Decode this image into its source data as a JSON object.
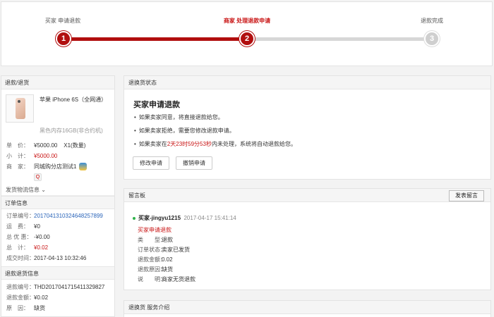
{
  "progress": {
    "steps": [
      {
        "num": "1",
        "label": "买家 申请退款"
      },
      {
        "num": "2",
        "label": "商家 处理退款申请"
      },
      {
        "num": "3",
        "label": "退款完成"
      }
    ]
  },
  "left": {
    "refund_header": "退款/退货",
    "product": {
      "name": "苹果 iPhone 6S（全网通）",
      "spec": "黑色内存16GB(非合约机)"
    },
    "price_label": "单　价：",
    "price_value": "¥5000.00",
    "qty_value": "X1(数量)",
    "subtotal_label": "小　计：",
    "subtotal_value": "¥5000.00",
    "seller_label": "商　家：",
    "seller_value": "同城购分店测试1",
    "logistics_label": "发货物流信息",
    "order_header": "订单信息",
    "order_no_label": "订单编号：",
    "order_no_value": "20170413103246482578​99",
    "shipping_label": "运　费：",
    "shipping_value": "¥0",
    "discount_label": "总 优 惠：",
    "discount_value": "-¥0.00",
    "total_label": "总　计：",
    "total_value": "¥0.02",
    "time_label": "成交时间：",
    "time_value": "2017-04-13 10:32:46",
    "return_header": "退款退货信息",
    "return_no_label": "退款编号：",
    "return_no_value": "THD20170417154113298​27",
    "return_amount_label": "退款金额：",
    "return_amount_value": "¥0.02",
    "reason_label": "原　因：",
    "reason_value": "缺货"
  },
  "status_panel": {
    "header": "退换货状态",
    "title": "买家申请退款",
    "bullet1": "如果卖家同意，将直接退款给您。",
    "bullet2": "如果卖家拒绝，需要您修改退款申请。",
    "bullet3_pre": "如果卖家在",
    "bullet3_time": "2天23时59分53秒",
    "bullet3_post": "内未处理，系统将自动退款给您。",
    "btn_modify": "修改申请",
    "btn_cancel": "撤销申请"
  },
  "message_panel": {
    "header": "留言板",
    "post_button": "发表留言",
    "user": "买家-jingyu1215",
    "time": "2017-04-17 15:41:14",
    "event": "买家申请退款",
    "type_label": "类　　型：",
    "type_value": "退款",
    "order_status_label": "订单状态：",
    "order_status_value": "卖家已发货",
    "amount_label": "退款金额：",
    "amount_value": "0.02",
    "reason_label": "退款原因：",
    "reason_value": "缺货",
    "note_label": "说　　明：",
    "note_value": "商家无货退款"
  },
  "service_panel": {
    "header": "退换货 服务介绍"
  },
  "colors": {
    "accent": "#b10e0e",
    "red_text": "#c91515",
    "link": "#2a64b9"
  }
}
